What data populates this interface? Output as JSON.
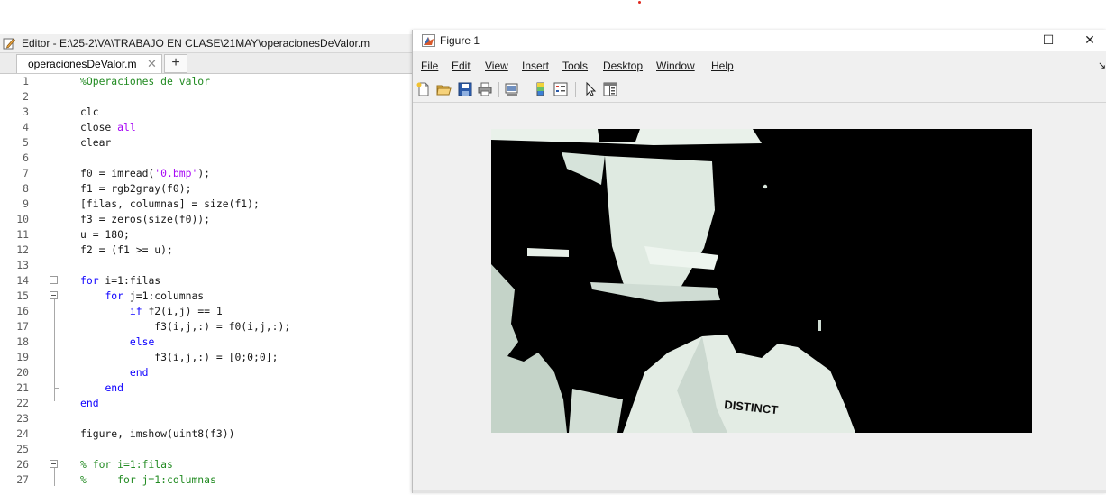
{
  "editor": {
    "title": "Editor - E:\\25-2\\VA\\TRABAJO EN CLASE\\21MAY\\operacionesDeValor.m",
    "tab_label": "operacionesDeValor.m",
    "close_glyph": "✕",
    "add_glyph": "+",
    "lines": [
      {
        "n": "1",
        "parts": [
          {
            "t": "%Operaciones de valor",
            "c": "cmt"
          }
        ]
      },
      {
        "n": "2",
        "parts": []
      },
      {
        "n": "3",
        "parts": [
          {
            "t": "clc"
          }
        ]
      },
      {
        "n": "4",
        "parts": [
          {
            "t": "close "
          },
          {
            "t": "all",
            "c": "str"
          }
        ]
      },
      {
        "n": "5",
        "parts": [
          {
            "t": "clear"
          }
        ]
      },
      {
        "n": "6",
        "parts": []
      },
      {
        "n": "7",
        "parts": [
          {
            "t": "f0 = imread("
          },
          {
            "t": "'0.bmp'",
            "c": "str"
          },
          {
            "t": ");"
          }
        ]
      },
      {
        "n": "8",
        "parts": [
          {
            "t": "f1 = rgb2gray(f0);"
          }
        ]
      },
      {
        "n": "9",
        "parts": [
          {
            "t": "[filas, columnas] = size(f1);"
          }
        ]
      },
      {
        "n": "10",
        "parts": [
          {
            "t": "f3 = zeros(size(f0));"
          }
        ]
      },
      {
        "n": "11",
        "parts": [
          {
            "t": "u = 180;"
          }
        ]
      },
      {
        "n": "12",
        "parts": [
          {
            "t": "f2 = (f1 >= u);"
          }
        ]
      },
      {
        "n": "13",
        "parts": []
      },
      {
        "n": "14",
        "parts": [
          {
            "t": "for",
            "c": "kw"
          },
          {
            "t": " i=1:filas"
          }
        ],
        "fold": true
      },
      {
        "n": "15",
        "parts": [
          {
            "t": "    "
          },
          {
            "t": "for",
            "c": "kw"
          },
          {
            "t": " j=1:columnas"
          }
        ],
        "fold": true
      },
      {
        "n": "16",
        "parts": [
          {
            "t": "        "
          },
          {
            "t": "if",
            "c": "kw"
          },
          {
            "t": " f2(i,j) == 1"
          }
        ]
      },
      {
        "n": "17",
        "parts": [
          {
            "t": "            f3(i,j,:) = f0(i,j,:);"
          }
        ]
      },
      {
        "n": "18",
        "parts": [
          {
            "t": "        "
          },
          {
            "t": "else",
            "c": "kw"
          }
        ]
      },
      {
        "n": "19",
        "parts": [
          {
            "t": "            f3(i,j,:) = [0;0;0];"
          }
        ]
      },
      {
        "n": "20",
        "parts": [
          {
            "t": "        "
          },
          {
            "t": "end",
            "c": "kw"
          }
        ]
      },
      {
        "n": "21",
        "parts": [
          {
            "t": "    "
          },
          {
            "t": "end",
            "c": "kw"
          }
        ]
      },
      {
        "n": "22",
        "parts": [
          {
            "t": "end",
            "c": "kw"
          }
        ]
      },
      {
        "n": "23",
        "parts": []
      },
      {
        "n": "24",
        "parts": [
          {
            "t": "figure, imshow(uint8(f3))"
          }
        ]
      },
      {
        "n": "25",
        "parts": []
      },
      {
        "n": "26",
        "parts": [
          {
            "t": "% for i=1:filas",
            "c": "cmt"
          }
        ],
        "fold": true
      },
      {
        "n": "27",
        "parts": [
          {
            "t": "%     for j=1:columnas",
            "c": "cmt"
          }
        ]
      }
    ]
  },
  "figure": {
    "title": "Figure 1",
    "window_buttons": {
      "minimize": "—",
      "maximize": "☐",
      "close": "✕"
    },
    "menus": [
      {
        "label": "File"
      },
      {
        "label": "Edit"
      },
      {
        "label": "View"
      },
      {
        "label": "Insert"
      },
      {
        "label": "Tools"
      },
      {
        "label": "Desktop"
      },
      {
        "label": "Window"
      },
      {
        "label": "Help"
      }
    ],
    "overflow_glyph": "↘",
    "toolbar_icons": [
      "new-figure-icon",
      "open-file-icon",
      "save-icon",
      "print-icon",
      "link-plot-icon",
      "colorbar-icon",
      "legend-icon",
      "pointer-icon",
      "property-inspector-icon"
    ],
    "image_subject": "thresholded-webcam-image",
    "image_text": "DISTINCT"
  },
  "colors": {
    "keyword": "#0e00ff",
    "string": "#a709f5",
    "comment": "#228b22"
  }
}
